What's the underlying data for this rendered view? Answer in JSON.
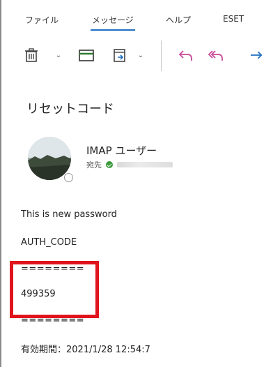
{
  "tabs": [
    "ファイル",
    "メッセージ",
    "ヘルプ",
    "ESET"
  ],
  "toolbar": {
    "icons": [
      "delete-icon",
      "archive-icon",
      "move-icon",
      "undo-icon",
      "undo-all-icon",
      "forward-icon"
    ]
  },
  "colors": {
    "accent": "#1f6fc4",
    "highlight": "#e0141c",
    "reply_icon": "#c94a9a",
    "archive_icon": "#2e7d32"
  },
  "email": {
    "subject": "リセットコード",
    "sender": "IMAP ユーザー",
    "recipient_label": "宛先",
    "body": {
      "line1": "This is new password",
      "line2": "AUTH_CODE",
      "separator_top": "========",
      "code": "499359",
      "separator_bottom": "========",
      "expiry": "有効期間：2021/1/28 12:54:7"
    }
  }
}
